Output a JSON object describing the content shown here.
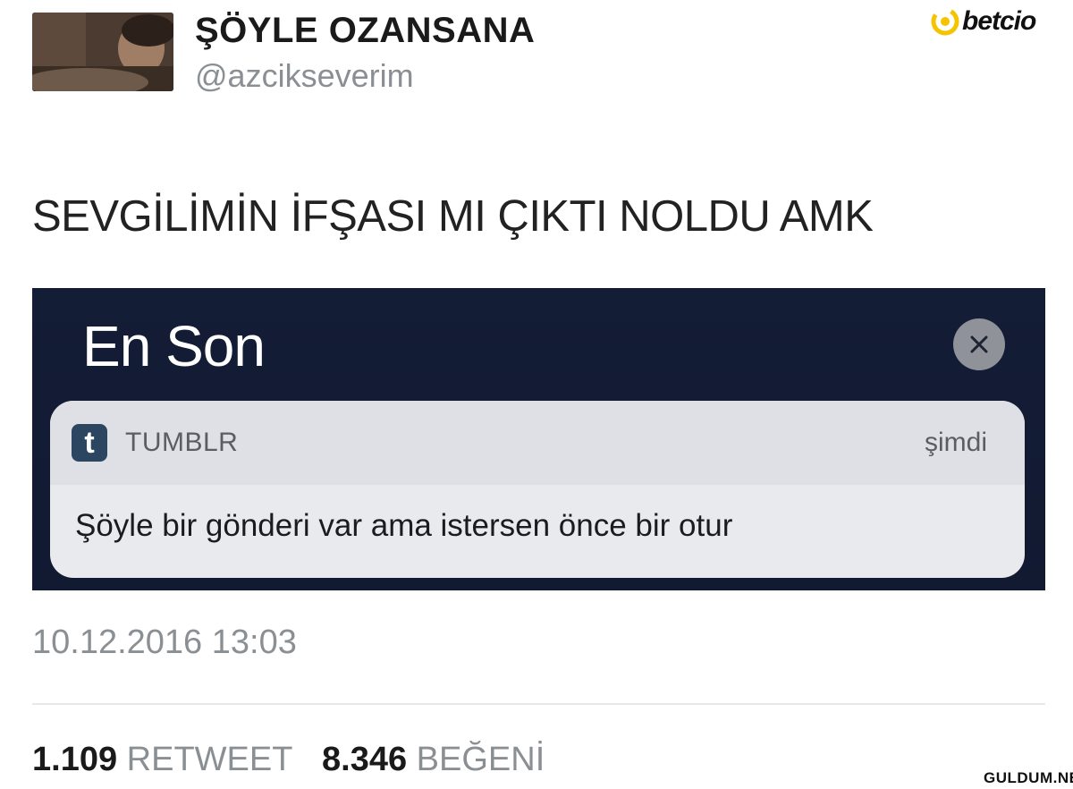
{
  "profile": {
    "display_name": "ŞÖYLE OZANSANA",
    "handle": "@azcikseverim"
  },
  "brand": {
    "logo_text": "betcio",
    "logo_icon": "betcio-logo-icon",
    "accent_color": "#f5c400"
  },
  "tweet": {
    "text": "SEVGİLİMİN İFŞASI MI ÇIKTI NOLDU AMK",
    "timestamp": "10.12.2016 13:03"
  },
  "screenshot": {
    "panel_title": "En Son",
    "close_icon": "close-icon",
    "notification": {
      "app_icon": "tumblr-icon",
      "app_icon_letter": "t",
      "app_name": "TUMBLR",
      "time": "şimdi",
      "message": "Şöyle bir gönderi var ama istersen önce bir otur"
    }
  },
  "stats": {
    "retweet_count": "1.109",
    "retweet_label": "RETWEET",
    "like_count": "8.346",
    "like_label": "BEĞENİ"
  },
  "watermark": {
    "text": "GULDUM.NET"
  },
  "colors": {
    "panel_background": "#141d36",
    "card_background": "#e9eaee",
    "muted_text": "#8a8f94",
    "tumblr_blue": "#2c4662"
  }
}
